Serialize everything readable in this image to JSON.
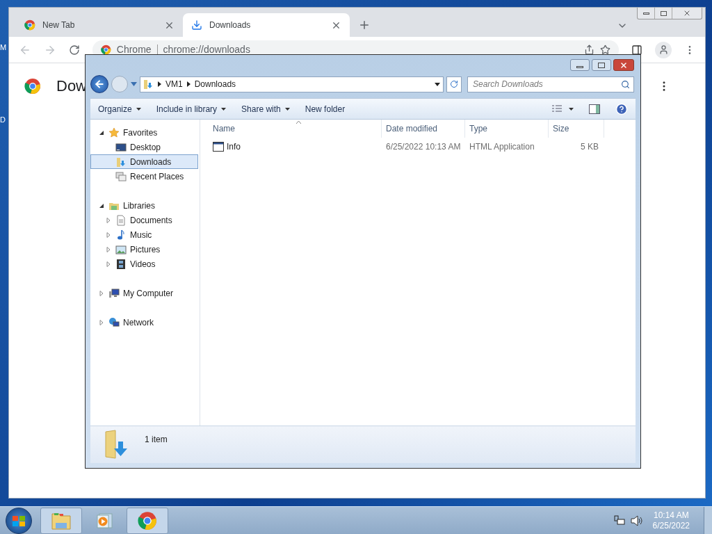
{
  "desktop_labels": [
    "M",
    "D"
  ],
  "chrome": {
    "tabs": [
      {
        "label": "New Tab",
        "selected": false,
        "kind": "chrome"
      },
      {
        "label": "Downloads",
        "selected": true,
        "kind": "download"
      }
    ],
    "address": {
      "site": "Chrome",
      "url": "chrome://downloads"
    },
    "page_heading": "Dow"
  },
  "explorer": {
    "breadcrumb": [
      "VM1",
      "Downloads"
    ],
    "search": {
      "placeholder": "Search Downloads"
    },
    "commands": [
      {
        "label": "Organize",
        "menu": true
      },
      {
        "label": "Include in library",
        "menu": true
      },
      {
        "label": "Share with",
        "menu": true
      },
      {
        "label": "New folder",
        "menu": false
      }
    ],
    "nav": [
      {
        "label": "Favorites",
        "kind": "star",
        "expanded": true,
        "selected": false,
        "children": [
          {
            "label": "Desktop",
            "kind": "desktop",
            "selected": false
          },
          {
            "label": "Downloads",
            "kind": "downloads",
            "selected": true
          },
          {
            "label": "Recent Places",
            "kind": "recent",
            "selected": false
          }
        ]
      },
      {
        "label": "Libraries",
        "kind": "library",
        "expanded": true,
        "selected": false,
        "children": [
          {
            "label": "Documents",
            "kind": "document",
            "expanded": false,
            "selected": false
          },
          {
            "label": "Music",
            "kind": "music",
            "expanded": false,
            "selected": false
          },
          {
            "label": "Pictures",
            "kind": "picture",
            "expanded": false,
            "selected": false
          },
          {
            "label": "Videos",
            "kind": "video",
            "expanded": false,
            "selected": false
          }
        ]
      },
      {
        "label": "My Computer",
        "kind": "computer",
        "expanded": false,
        "selected": false
      },
      {
        "label": "Network",
        "kind": "network",
        "expanded": false,
        "selected": false
      }
    ],
    "columns": [
      "Name",
      "Date modified",
      "Type",
      "Size"
    ],
    "rows": [
      {
        "name": "Info",
        "date": "6/25/2022 10:13 AM",
        "type": "HTML Application",
        "size": "5 KB"
      }
    ],
    "status": "1 item"
  },
  "taskbar": {
    "items": [
      {
        "kind": "explorer",
        "running": true
      },
      {
        "kind": "media",
        "running": false
      },
      {
        "kind": "chrome",
        "running": true
      }
    ],
    "time": "10:14 AM",
    "date": "6/25/2022"
  }
}
